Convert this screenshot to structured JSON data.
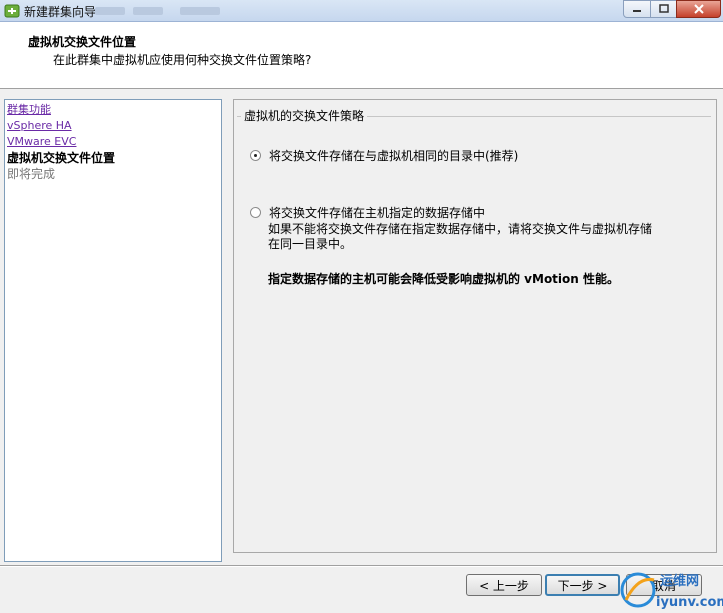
{
  "window": {
    "title": "新建群集向导"
  },
  "header": {
    "title": "虚拟机交换文件位置",
    "subtitle": "在此群集中虚拟机应使用何种交换文件位置策略?"
  },
  "nav": {
    "items": [
      {
        "label": "群集功能",
        "state": "link"
      },
      {
        "label": "vSphere HA",
        "state": "link"
      },
      {
        "label": "VMware EVC",
        "state": "link"
      },
      {
        "label": "虚拟机交换文件位置",
        "state": "current"
      },
      {
        "label": "即将完成",
        "state": "pending"
      }
    ]
  },
  "content": {
    "group_title": "虚拟机的交换文件策略",
    "option1": {
      "label": "将交换文件存储在与虚拟机相同的目录中(推荐)",
      "selected": true
    },
    "option2": {
      "label": "将交换文件存储在主机指定的数据存储中",
      "selected": false,
      "description_line1": "如果不能将交换文件存储在指定数据存储中，请将交换文件与虚拟机存储",
      "description_line2": "在同一目录中。",
      "warning": "指定数据存储的主机可能会降低受影响虚拟机的 vMotion 性能。"
    }
  },
  "footer": {
    "back_label": "< 上一步",
    "next_label": "下一步 >",
    "cancel_label": "取消"
  },
  "watermark": {
    "line1": "运维网",
    "line2": "iyunv.com"
  },
  "colors": {
    "link": "#6a2aa6",
    "titlebar": "#c6d7ee",
    "close_button": "#c5412b",
    "default_button_border": "#3c7fb1"
  }
}
